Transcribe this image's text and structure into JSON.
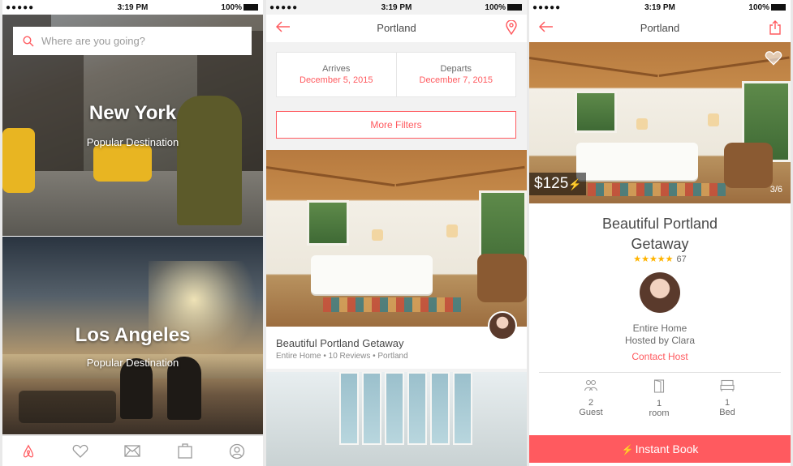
{
  "status": {
    "signal": "●●●●● ",
    "time": "3:19 PM",
    "battery": "100%"
  },
  "screen1": {
    "search_placeholder": "Where are you going?",
    "destinations": [
      {
        "title": "New York",
        "subtitle": "Popular Destination"
      },
      {
        "title": "Los Angeles",
        "subtitle": "Popular Destination"
      }
    ],
    "tabs": [
      "airbnb-logo-icon",
      "heart-icon",
      "mail-icon",
      "suitcase-icon",
      "profile-icon"
    ]
  },
  "screen2": {
    "title": "Portland",
    "arrives_label": "Arrives",
    "arrives_date": "December 5, 2015",
    "departs_label": "Departs",
    "departs_date": "December 7, 2015",
    "filters_label": "More Filters",
    "listing": {
      "name": "Beautiful Portland Getaway",
      "meta": "Entire Home • 10 Reviews • Portland"
    }
  },
  "screen3": {
    "title": "Portland",
    "price": "$125",
    "photo_counter": "3/6",
    "listing_title": "Beautiful Portland Getaway",
    "stars": "★★★★★",
    "review_count": "67",
    "home_type": "Entire Home",
    "hosted_by": "Hosted by Clara",
    "contact_label": "Contact Host",
    "amenities": [
      {
        "value": "2",
        "label": "Guest",
        "icon": "guests-icon"
      },
      {
        "value": "1",
        "label": "room",
        "icon": "door-icon"
      },
      {
        "value": "1",
        "label": "Bed",
        "icon": "bed-icon"
      }
    ],
    "instant_book": "Instant Book"
  },
  "colors": {
    "brand": "#ff5a5f",
    "star": "#ffb400"
  }
}
